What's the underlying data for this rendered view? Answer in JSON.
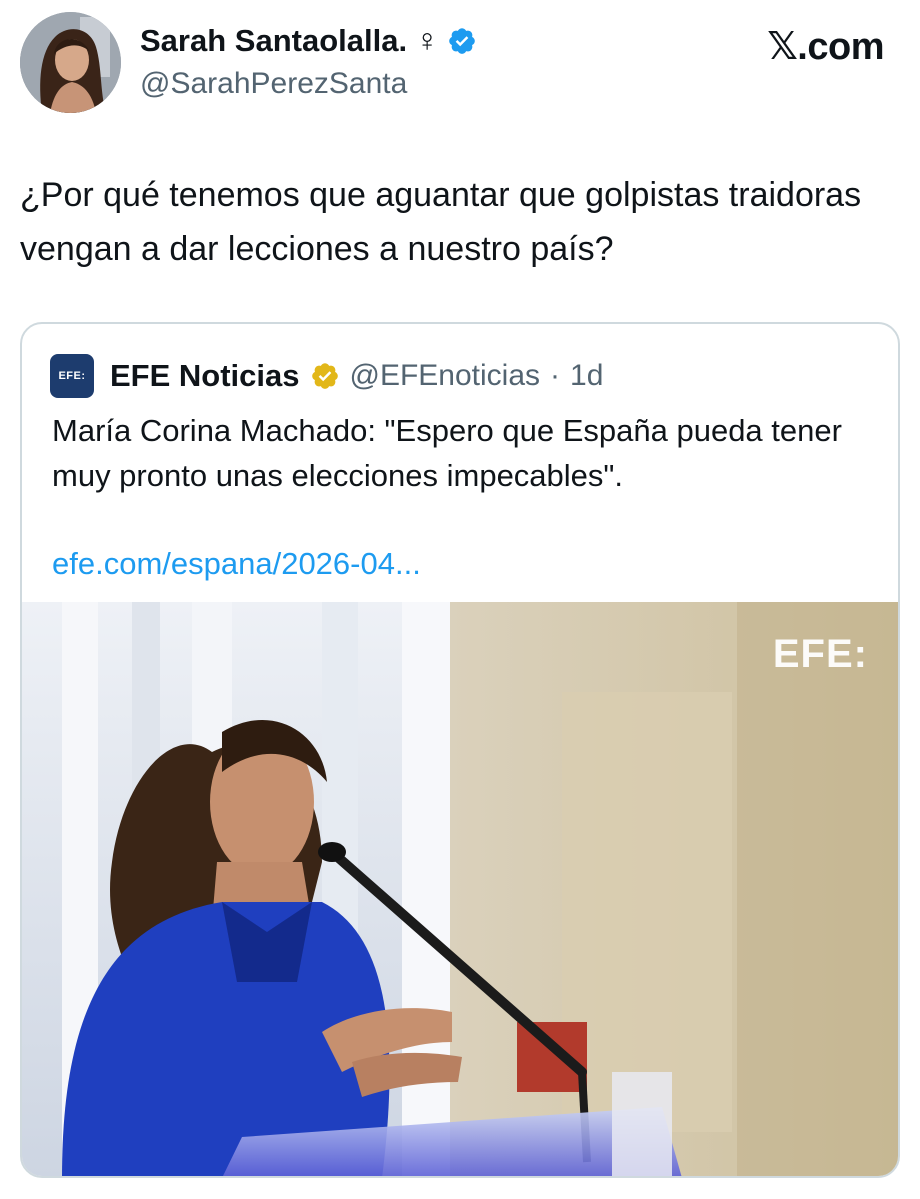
{
  "author": {
    "display_name": "Sarah Santaolalla.",
    "gender_symbol": "♀",
    "handle": "@SarahPerezSanta",
    "verified_badge": "blue-check-icon",
    "badge_color": "#1d9bf0"
  },
  "brand": "𝕏.com",
  "tweet": {
    "text": "¿Por qué tenemos que aguantar que golpistas traidoras vengan a dar lecciones a nuestro país?"
  },
  "quoted": {
    "logo_text": "EFE:",
    "display_name": "EFE Noticias",
    "badge_color": "#e2b719",
    "handle": "@EFEnoticias",
    "separator": "·",
    "time": "1d",
    "text": "María Corina Machado: \"Espero que España pueda tener muy pronto unas elecciones impecables\".",
    "link": "efe.com/espana/2026-04...",
    "image_watermark": "EFE:"
  }
}
